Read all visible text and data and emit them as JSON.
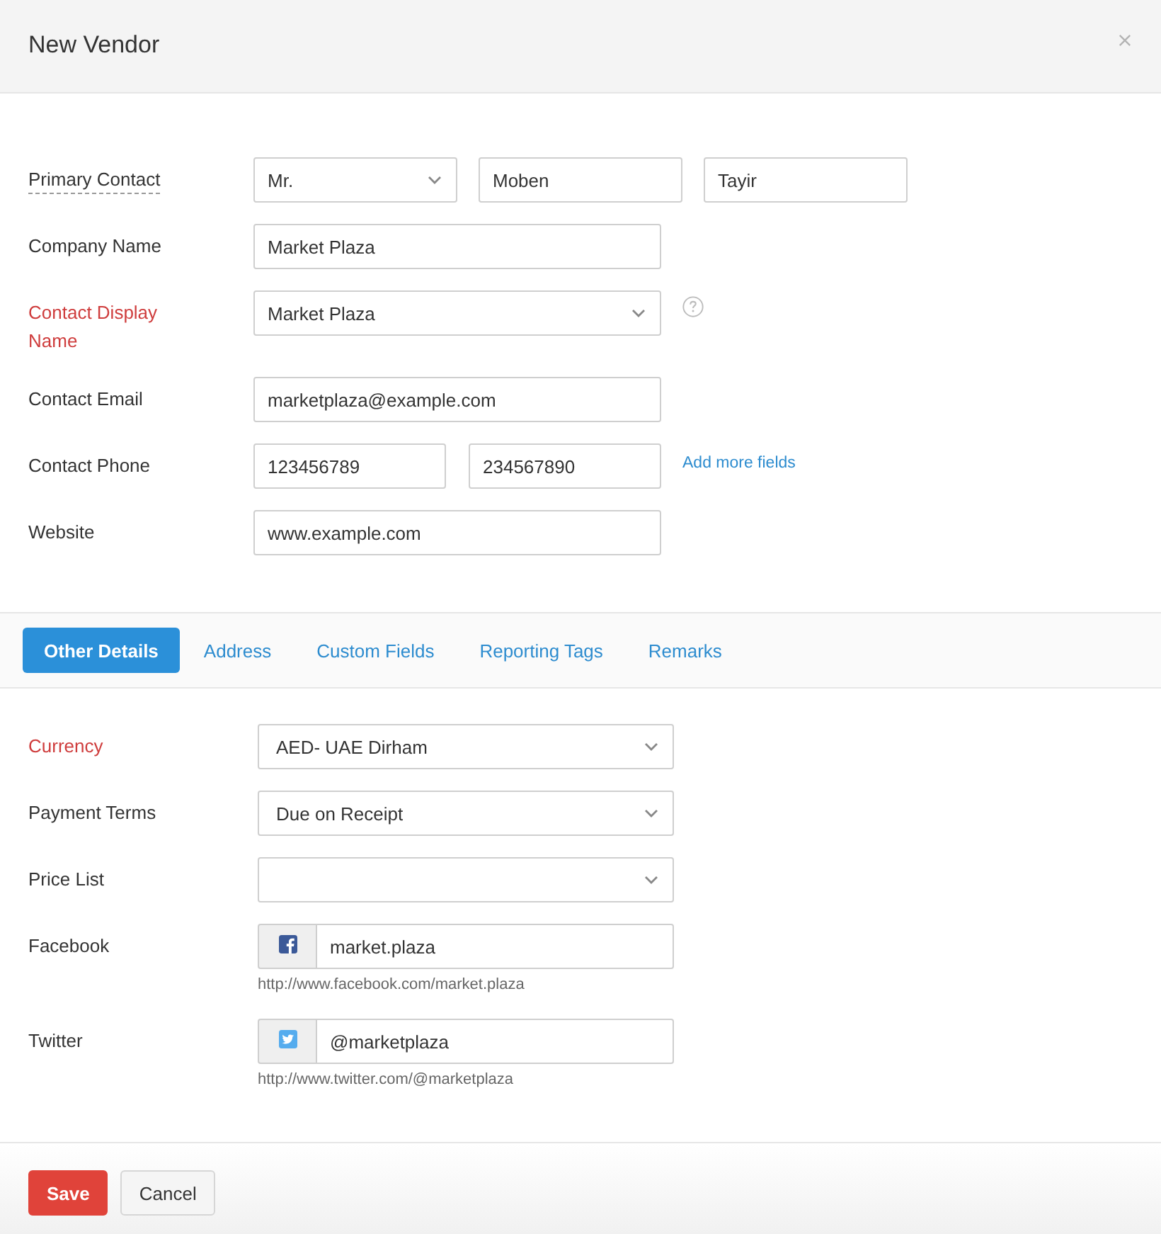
{
  "dialog": {
    "title": "New Vendor"
  },
  "contact_rows": [
    {
      "label": "Primary Contact",
      "required": false,
      "dashed_underline": true,
      "help": false,
      "controls": [
        {
          "kind": "select",
          "value": "Mr."
        },
        {
          "kind": "input",
          "value": "Moben"
        },
        {
          "kind": "input",
          "value": "Tayir"
        }
      ]
    },
    {
      "label": "Company Name",
      "required": false,
      "dashed_underline": false,
      "help": false,
      "controls": [
        {
          "kind": "input",
          "value": "Market Plaza"
        }
      ]
    },
    {
      "label": "Contact Display Name",
      "required": true,
      "dashed_underline": false,
      "help": true,
      "controls": [
        {
          "kind": "select",
          "value": "Market Plaza"
        }
      ]
    },
    {
      "label": "Contact Email",
      "required": false,
      "dashed_underline": false,
      "help": false,
      "controls": [
        {
          "kind": "input",
          "value": "marketplaza@example.com"
        }
      ]
    },
    {
      "label": "Contact Phone",
      "required": false,
      "dashed_underline": false,
      "help": false,
      "controls": [
        {
          "kind": "input",
          "value": "123456789"
        },
        {
          "kind": "input",
          "value": "234567890"
        }
      ],
      "link": "Add more fields"
    },
    {
      "label": "Website",
      "required": false,
      "dashed_underline": false,
      "help": false,
      "controls": [
        {
          "kind": "input",
          "value": "www.example.com"
        }
      ]
    }
  ],
  "tabs": [
    {
      "label": "Other Details",
      "selected": true
    },
    {
      "label": "Address",
      "selected": false
    },
    {
      "label": "Custom Fields",
      "selected": false
    },
    {
      "label": "Reporting Tags",
      "selected": false
    },
    {
      "label": "Remarks",
      "selected": false
    }
  ],
  "detail_rows": [
    {
      "label": "Currency",
      "required": true,
      "kind": "select",
      "value": "AED- UAE Dirham"
    },
    {
      "label": "Payment Terms",
      "required": false,
      "kind": "select",
      "value": "Due on Receipt"
    },
    {
      "label": "Price List",
      "required": false,
      "kind": "select"
    },
    {
      "label": "Facebook",
      "required": false,
      "kind": "facebook",
      "value": "market.plaza",
      "url": "http://www.facebook.com/market.plaza"
    },
    {
      "label": "Twitter",
      "required": false,
      "kind": "twitter",
      "value": "@marketplaza",
      "url": "http://www.twitter.com/@marketplaza"
    }
  ],
  "buttons": [
    {
      "label": "Save",
      "kind": "primary"
    },
    {
      "label": "Cancel",
      "kind": "secondary"
    }
  ]
}
